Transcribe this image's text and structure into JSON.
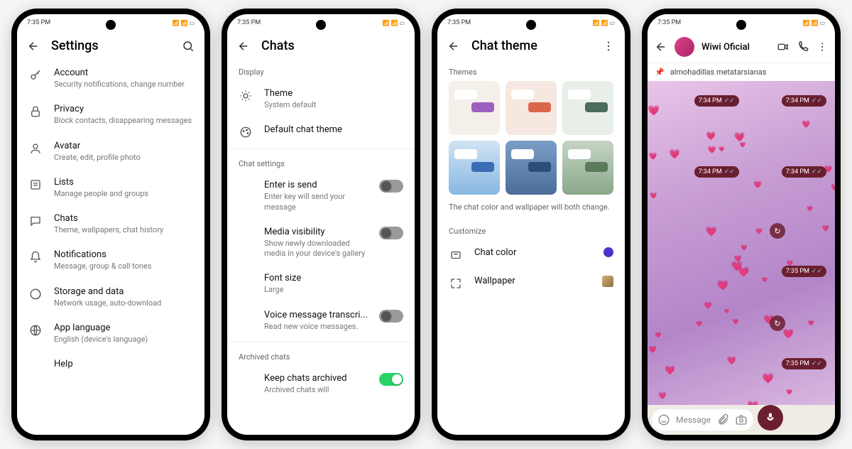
{
  "status": {
    "time": "7:35 PM",
    "indicators": "⟐ ☷ ⋮⋮ 📶 ▢"
  },
  "screen1": {
    "title": "Settings",
    "items": [
      {
        "label": "Account",
        "sub": "Security notifications, change number"
      },
      {
        "label": "Privacy",
        "sub": "Block contacts, disappearing messages"
      },
      {
        "label": "Avatar",
        "sub": "Create, edit, profile photo"
      },
      {
        "label": "Lists",
        "sub": "Manage people and groups"
      },
      {
        "label": "Chats",
        "sub": "Theme, wallpapers, chat history"
      },
      {
        "label": "Notifications",
        "sub": "Message, group & call tones"
      },
      {
        "label": "Storage and data",
        "sub": "Network usage, auto-download"
      },
      {
        "label": "App language",
        "sub": "English (device's language)"
      },
      {
        "label": "Help",
        "sub": ""
      }
    ]
  },
  "screen2": {
    "title": "Chats",
    "section_display": "Display",
    "theme": {
      "label": "Theme",
      "sub": "System default"
    },
    "default_theme": {
      "label": "Default chat theme"
    },
    "section_chat": "Chat settings",
    "enter_send": {
      "label": "Enter is send",
      "sub": "Enter key will send your message"
    },
    "media_vis": {
      "label": "Media visibility",
      "sub": "Show newly downloaded media in your device's gallery"
    },
    "font_size": {
      "label": "Font size",
      "sub": "Large"
    },
    "voice_trans": {
      "label": "Voice message transcri...",
      "sub": "Read new voice messages."
    },
    "section_archive": "Archived chats",
    "keep_archived": {
      "label": "Keep chats archived",
      "sub": "Archived chats will"
    }
  },
  "screen3": {
    "title": "Chat theme",
    "section_themes": "Themes",
    "hint": "The chat color and wallpaper will both change.",
    "section_customize": "Customize",
    "chat_color": {
      "label": "Chat color",
      "color": "#4836c9"
    },
    "wallpaper": {
      "label": "Wallpaper"
    },
    "tiles": [
      {
        "bg": "#f4efe8",
        "out": "#9c5fbf"
      },
      {
        "bg": "#f5e8e0",
        "out": "#d9664b"
      },
      {
        "bg": "#e8efe8",
        "out": "#4a6b5d"
      },
      {
        "bg": "linear-gradient(#d0e4f5,#87b8e0)",
        "out": "#3a6db5"
      },
      {
        "bg": "linear-gradient(#7a9fc5,#4a6d99)",
        "out": "#2a4d7a"
      },
      {
        "bg": "linear-gradient(#c5d5c5,#8aa88a)",
        "out": "#5a7a5a"
      }
    ]
  },
  "screen4": {
    "contact": "Wiwi Oficial",
    "pinned": "almohadillas metatarsianas",
    "placeholder": "Message",
    "msgs": [
      {
        "t": "7:34 PM"
      },
      {
        "t": "7:34 PM"
      },
      {
        "t": "7:34 PM"
      },
      {
        "t": "7:34 PM"
      },
      {
        "t": "7:35 PM"
      },
      {
        "t": "7:35 PM"
      }
    ]
  }
}
